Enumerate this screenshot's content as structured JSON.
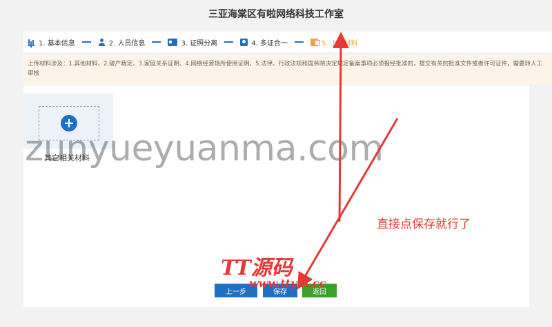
{
  "header": {
    "title": "三亚海棠区有啦网络科技工作室"
  },
  "steps": [
    {
      "label": "1. 基本信息",
      "icon": "bar-chart-icon"
    },
    {
      "label": "2. 人员信息",
      "icon": "person-icon"
    },
    {
      "label": "3. 证照分离",
      "icon": "id-card-icon"
    },
    {
      "label": "4. 多证合一",
      "icon": "portrait-icon"
    },
    {
      "label": "5. 上传材料",
      "icon": "upload-file-icon"
    }
  ],
  "active_step": 5,
  "notice": {
    "text": "上传材料涉及：1.其他材料、2.破产裁定、3.家庭关系证明、4.网络经营场所使用证明、5.法律、行政法规和国务院决定规定备案事项必须报经批准的，提交有关的批准文件或者许可证件，需要转人工审核"
  },
  "upload": {
    "label": "其它相关材料"
  },
  "buttons": {
    "prev": "上一步",
    "save": "保存",
    "back": "返回"
  },
  "overlays": {
    "watermark": "zunyueyuanma.com",
    "annotation": "直接点保存就行了",
    "logo": "TT源码",
    "logo_url": "www.ttym.cc"
  },
  "colors": {
    "primary": "#1f6fc5",
    "active_step": "#f0a048",
    "back_button": "#3aa02a",
    "annotation": "#e53935",
    "notice_bg": "#fdf3e6"
  }
}
